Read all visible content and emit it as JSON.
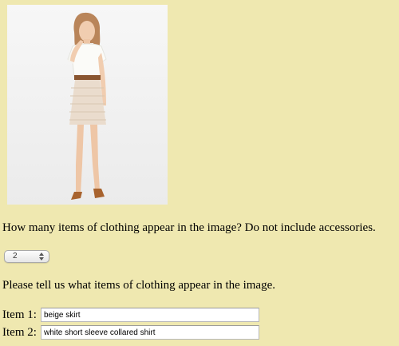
{
  "question_count": "How many items of clothing appear in the image? Do not include accessories.",
  "count_select": {
    "selected": "2"
  },
  "question_items": "Please tell us what items of clothing appear in the image.",
  "items": [
    {
      "label": "Item 1:",
      "value": "beige skirt"
    },
    {
      "label": "Item 2:",
      "value": "white short sleeve collared shirt"
    }
  ],
  "colors": {
    "page_background": "#efe8b0",
    "photo_background": "#f4f4f4"
  }
}
